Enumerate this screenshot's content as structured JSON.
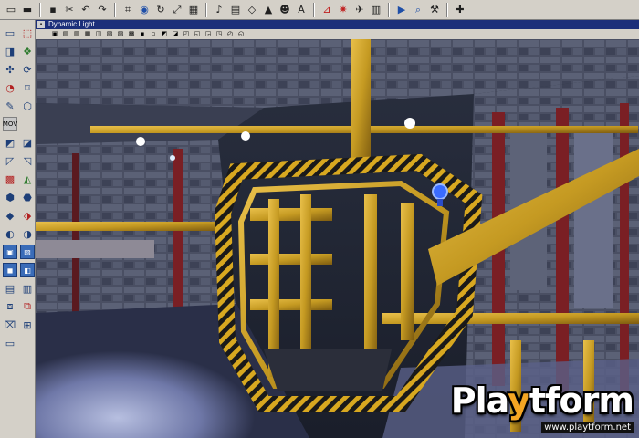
{
  "viewport": {
    "title": "Dynamic Light"
  },
  "toolbar": {
    "buttons": [
      {
        "name": "new-icon",
        "glyph": "▭"
      },
      {
        "name": "open-icon",
        "glyph": "▬"
      },
      {
        "name": "save-icon",
        "glyph": "▪"
      },
      {
        "name": "cut-icon",
        "glyph": "✂"
      },
      {
        "name": "undo-icon",
        "glyph": "↶"
      },
      {
        "name": "redo-icon",
        "glyph": "↷"
      },
      {
        "name": "grid-icon",
        "glyph": "⌗"
      },
      {
        "name": "camera-icon",
        "glyph": "◉"
      },
      {
        "name": "rotate-icon",
        "glyph": "↻"
      },
      {
        "name": "scale-icon",
        "glyph": "⤢"
      },
      {
        "name": "select-icon",
        "glyph": "▦"
      },
      {
        "name": "music-icon",
        "glyph": "♪"
      },
      {
        "name": "texture-icon",
        "glyph": "▤"
      },
      {
        "name": "mesh-icon",
        "glyph": "◇"
      },
      {
        "name": "terrain-icon",
        "glyph": "▲"
      },
      {
        "name": "actor-icon",
        "glyph": "☻"
      },
      {
        "name": "text-icon",
        "glyph": "A"
      },
      {
        "name": "build-geometry-icon",
        "glyph": "⊿"
      },
      {
        "name": "build-lighting-icon",
        "glyph": "✷"
      },
      {
        "name": "build-paths-icon",
        "glyph": "✈"
      },
      {
        "name": "build-all-icon",
        "glyph": "▥"
      },
      {
        "name": "play-level-icon",
        "glyph": "▶"
      },
      {
        "name": "search-icon",
        "glyph": "⌕"
      },
      {
        "name": "tools-icon",
        "glyph": "⚒"
      },
      {
        "name": "help-icon",
        "glyph": "✚"
      }
    ],
    "accent": "#c02020"
  },
  "sidebar": {
    "buttons": [
      {
        "name": "camera-mode-icon",
        "glyph": "▭"
      },
      {
        "name": "move-camera-icon",
        "glyph": "⬚"
      },
      {
        "name": "vertex-edit-icon",
        "glyph": "◨"
      },
      {
        "name": "texture-pan-icon",
        "glyph": "❖"
      },
      {
        "name": "brush-clip-icon",
        "glyph": "✣"
      },
      {
        "name": "face-drag-icon",
        "glyph": "⟳"
      },
      {
        "name": "terrain-edit-icon",
        "glyph": "◔"
      },
      {
        "name": "matinee-icon",
        "glyph": "⌑"
      },
      {
        "name": "paint-icon",
        "glyph": "✎"
      },
      {
        "name": "polygon-icon",
        "glyph": "⬡"
      },
      {
        "name": "mover-icon",
        "glyph": "MOV"
      },
      {
        "name": "spacer-icon",
        "glyph": ""
      },
      {
        "name": "cube-builder-icon",
        "glyph": "◩"
      },
      {
        "name": "stair-builder-icon",
        "glyph": "◪"
      },
      {
        "name": "sheet-builder-icon",
        "glyph": "◸"
      },
      {
        "name": "cylinder-builder-icon",
        "glyph": "◹"
      },
      {
        "name": "cone-builder-icon",
        "glyph": "▩"
      },
      {
        "name": "sphere-builder-icon",
        "glyph": "◭"
      },
      {
        "name": "curved-stair-icon",
        "glyph": "⬢"
      },
      {
        "name": "volumetric-icon",
        "glyph": "⬣"
      },
      {
        "name": "add-brush-icon",
        "glyph": "◆"
      },
      {
        "name": "subtract-brush-icon",
        "glyph": "⬗"
      },
      {
        "name": "intersect-icon",
        "glyph": "◐"
      },
      {
        "name": "deintersect-icon",
        "glyph": "◑"
      },
      {
        "name": "add-special-icon",
        "glyph": "▣"
      },
      {
        "name": "add-mover-icon",
        "glyph": "▨"
      },
      {
        "name": "add-static-mesh-icon",
        "glyph": "◼"
      },
      {
        "name": "add-volume-icon",
        "glyph": "◧"
      },
      {
        "name": "show-selected-icon",
        "glyph": "▤"
      },
      {
        "name": "hide-selected-icon",
        "glyph": "▥"
      },
      {
        "name": "select-all-icon",
        "glyph": "⧈"
      },
      {
        "name": "invert-select-icon",
        "glyph": "⧉"
      },
      {
        "name": "show-all-icon",
        "glyph": "⌧"
      },
      {
        "name": "zoom-icon",
        "glyph": "⊞"
      },
      {
        "name": "snap-icon",
        "glyph": "▭"
      },
      {
        "name": "spacer-icon-2",
        "glyph": ""
      }
    ]
  },
  "viewport_bar": {
    "buttons": [
      "▣",
      "▤",
      "▥",
      "▦",
      "◫",
      "▧",
      "▨",
      "▩",
      "▪",
      "▫",
      "◩",
      "◪",
      "◰",
      "◱",
      "◲",
      "◳",
      "◴",
      "◵"
    ]
  },
  "watermark": {
    "brand_pre": "Pla",
    "brand_y": "y",
    "brand_post": "tform",
    "url": "www.playtform.net",
    "accent": "#f5a623"
  }
}
